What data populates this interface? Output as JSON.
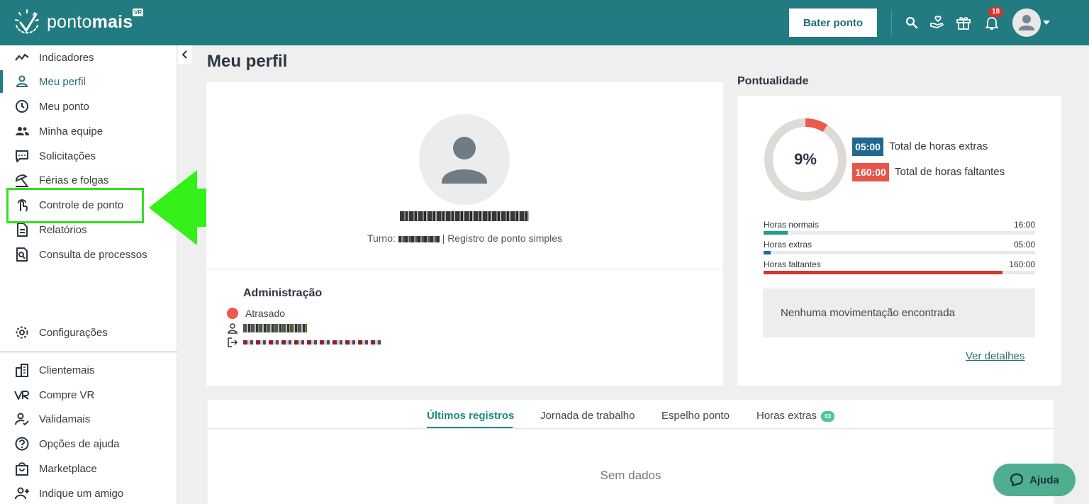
{
  "header": {
    "logo_text_regular": "ponto",
    "logo_text_bold": "mais",
    "logo_badge": "VR",
    "bater_ponto": "Bater ponto",
    "notifications_count": "18"
  },
  "sidebar": {
    "items": [
      {
        "label": "Indicadores",
        "icon": "chart-line-icon"
      },
      {
        "label": "Meu perfil",
        "icon": "person-icon"
      },
      {
        "label": "Meu ponto",
        "icon": "clock-icon"
      },
      {
        "label": "Minha equipe",
        "icon": "group-icon"
      },
      {
        "label": "Solicitações",
        "icon": "chat-icon"
      },
      {
        "label": "Férias e folgas",
        "icon": "umbrella-icon"
      },
      {
        "label": "Controle de ponto",
        "icon": "finger-icon"
      },
      {
        "label": "Relatórios",
        "icon": "document-icon"
      },
      {
        "label": "Consulta de processos",
        "icon": "search-doc-icon"
      }
    ],
    "settings": "Configurações",
    "extras": [
      {
        "label": "Clientemais"
      },
      {
        "label": "Compre VR"
      },
      {
        "label": "Validamais"
      },
      {
        "label": "Opções de ajuda"
      },
      {
        "label": "Marketplace"
      },
      {
        "label": "Indique um amigo"
      }
    ]
  },
  "main": {
    "title": "Meu perfil",
    "profile": {
      "turno_prefix": "Turno:",
      "turno_suffix": "| Registro de ponto simples",
      "section_title": "Administração",
      "status": "Atrasado"
    },
    "pontualidade": {
      "title": "Pontualidade",
      "percent": "9%",
      "percent_value": 0.09,
      "extras_value": "05:00",
      "extras_label": "Total de horas extras",
      "faltantes_value": "160:00",
      "faltantes_label": "Total de horas faltantes",
      "bars": [
        {
          "label": "Horas normais",
          "value": "16:00",
          "fraction": 0.09,
          "color": "#1aa37d"
        },
        {
          "label": "Horas extras",
          "value": "05:00",
          "fraction": 0.025,
          "color": "#1f6f99"
        },
        {
          "label": "Horas faltantes",
          "value": "160:00",
          "fraction": 0.88,
          "color": "#d1372b"
        }
      ],
      "empty_message": "Nenhuma movimentação encontrada",
      "details_link": "Ver detalhes"
    },
    "tabs": [
      {
        "label": "Últimos registros"
      },
      {
        "label": "Jornada de trabalho"
      },
      {
        "label": "Espelho ponto"
      },
      {
        "label": "Horas extras",
        "badge": "03"
      }
    ],
    "empty_tab": "Sem dados"
  },
  "help_button": "Ajuda",
  "colors": {
    "brand": "#227b80",
    "accent_green": "#33e01d",
    "danger": "#ec5a4d"
  }
}
